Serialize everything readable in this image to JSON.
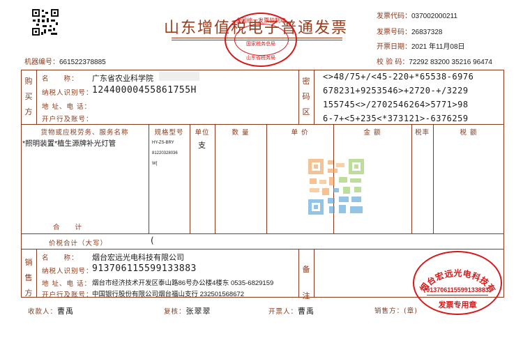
{
  "invoice": {
    "title": "山东增值税电子普通发票",
    "code_label": "发票代码：",
    "code": "037002000211",
    "number_label": "发票号码：",
    "number": "26837328",
    "date_label": "开票日期：",
    "date": "2021 年11月08日",
    "check_label": "校 验 码：",
    "check": "72292 83200 35216 96474",
    "machine_label": "机器编号：",
    "machine": "661522378885"
  },
  "tax_seal": {
    "line1": "全国统一发票监制章",
    "line2": "国家税务总局",
    "line3": "山东省税务局"
  },
  "buyer": {
    "side": "购买方",
    "name_label": "名　　称：",
    "name": "广东省农业科学院",
    "taxid_label": "纳税人识别号：",
    "taxid": "12440000455861755H",
    "address_label": "地 址、电 话：",
    "bank_label": "开户行及账号："
  },
  "cipher": {
    "side": "密码区",
    "lines": [
      "<>48/75+/<45-220+*65538-6976",
      "678231+9253546>+2720-+/3229",
      "155745<>/2702546264>5771>98",
      "6-7+<5+235<*373121>-6376259"
    ]
  },
  "columns": {
    "goods": "货物或应税劳务、服务名称",
    "spec": "规格型号",
    "unit": "单位",
    "qty": "数 量",
    "price": "单 价",
    "amount": "金 额",
    "rate": "税率",
    "tax": "税 额"
  },
  "item": {
    "goods": "*照明装置*植生源牌补光灯管",
    "spec1": "HY-ZS-BRY",
    "spec2": "81220328036",
    "spec3": "W[",
    "unit": "支"
  },
  "totals": {
    "sum_label": "合　　计",
    "total_label": "价税合计（大写）",
    "total_mark": "("
  },
  "seller": {
    "side": "销售方",
    "name_label": "名　　称：",
    "name": "烟台宏远光电科技有限公司",
    "taxid_label": "纳税人识别号：",
    "taxid": "913706115599133883",
    "address_label": "地 址、电 话：",
    "address": "烟台市经济技术开发区泰山路86号办公楼4楼东 0535-6829159",
    "bank_label": "开户行及账号：",
    "bank": "中国银行股份有限公司烟台福山支行 232501568672"
  },
  "remarks": {
    "side": "备注"
  },
  "footer": {
    "payee_label": "收款人：",
    "payee": "曹禹",
    "review_label": "复核：",
    "review": "张翠翠",
    "drawer_label": "开票人：",
    "drawer": "曹禹",
    "seller_label": "销售方：(章)"
  },
  "seller_stamp": {
    "company": "烟台宏远光电科技有限公司",
    "taxid": "913706115599133883",
    "label": "发票专用章"
  },
  "colors": {
    "frame": "#8a3a1c",
    "seal": "#d81818",
    "ink": "#1a1a1a"
  }
}
